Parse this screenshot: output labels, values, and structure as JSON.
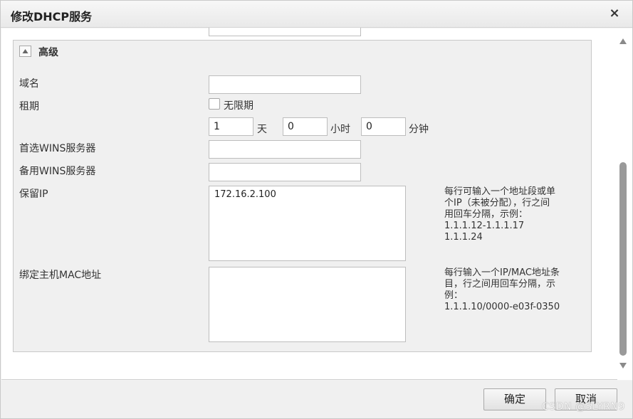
{
  "dialog": {
    "title": "修改DHCP服务",
    "close_label": "×"
  },
  "advanced": {
    "title": "高级",
    "toggle_icon": "triangle-up-icon"
  },
  "form": {
    "domain": {
      "label": "域名",
      "value": ""
    },
    "lease": {
      "label": "租期",
      "unlimited_label": "无限期",
      "unlimited_checked": false,
      "days_value": "1",
      "days_unit": "天",
      "hours_value": "0",
      "hours_unit": "小时",
      "minutes_value": "0",
      "minutes_unit": "分钟"
    },
    "primary_wins": {
      "label": "首选WINS服务器",
      "value": ""
    },
    "backup_wins": {
      "label": "备用WINS服务器",
      "value": ""
    },
    "reserved_ip": {
      "label": "保留IP",
      "value": "172.16.2.100",
      "hint_lines": [
        "每行可输入一个地址段或单",
        "个IP（未被分配），行之间",
        "用回车分隔，示例：",
        "1.1.1.12-1.1.1.17",
        "1.1.1.24"
      ]
    },
    "bind_mac": {
      "label": "绑定主机MAC地址",
      "value": "",
      "hint_lines": [
        "每行输入一个IP/MAC地址条",
        "目，行之间用回车分隔，示",
        "例：",
        "1.1.1.10/0000-e03f-0350"
      ]
    }
  },
  "footer": {
    "ok_label": "确定",
    "cancel_label": "取消"
  },
  "watermark": "CSDN @SLYRN9"
}
